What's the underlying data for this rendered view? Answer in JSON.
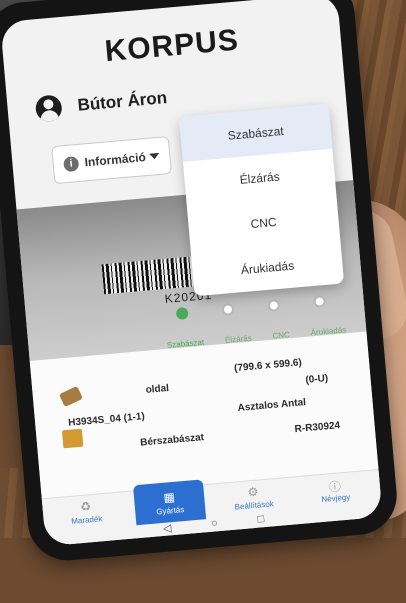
{
  "app": {
    "logo": "KORPUS"
  },
  "user": {
    "name": "Bútor Áron"
  },
  "info_select": {
    "label": "Információ"
  },
  "dropdown": {
    "items": [
      "Szabászat",
      "Élzárás",
      "CNC",
      "Árukiadás"
    ],
    "selected_index": 0
  },
  "barcode": {
    "text": "K20201"
  },
  "steps": {
    "labels": [
      "Szabászat",
      "Élzárás",
      "CNC",
      "Árukiadás"
    ],
    "active_index": 0
  },
  "order": {
    "dimensions": "(799.6 x 599.6)",
    "side": "oldal",
    "edge": "(0-U)",
    "code": "H3934S_04 (1-1)",
    "customer": "Asztalos Antal",
    "process": "Bérszabászat",
    "ref": "R-R30924"
  },
  "nav": {
    "items": [
      "Maradék",
      "Gyártás",
      "Beállítások",
      "Névjegy"
    ],
    "active": "Gyártás"
  },
  "colors": {
    "accent": "#2c6fd1",
    "step_active": "#4caa57"
  }
}
